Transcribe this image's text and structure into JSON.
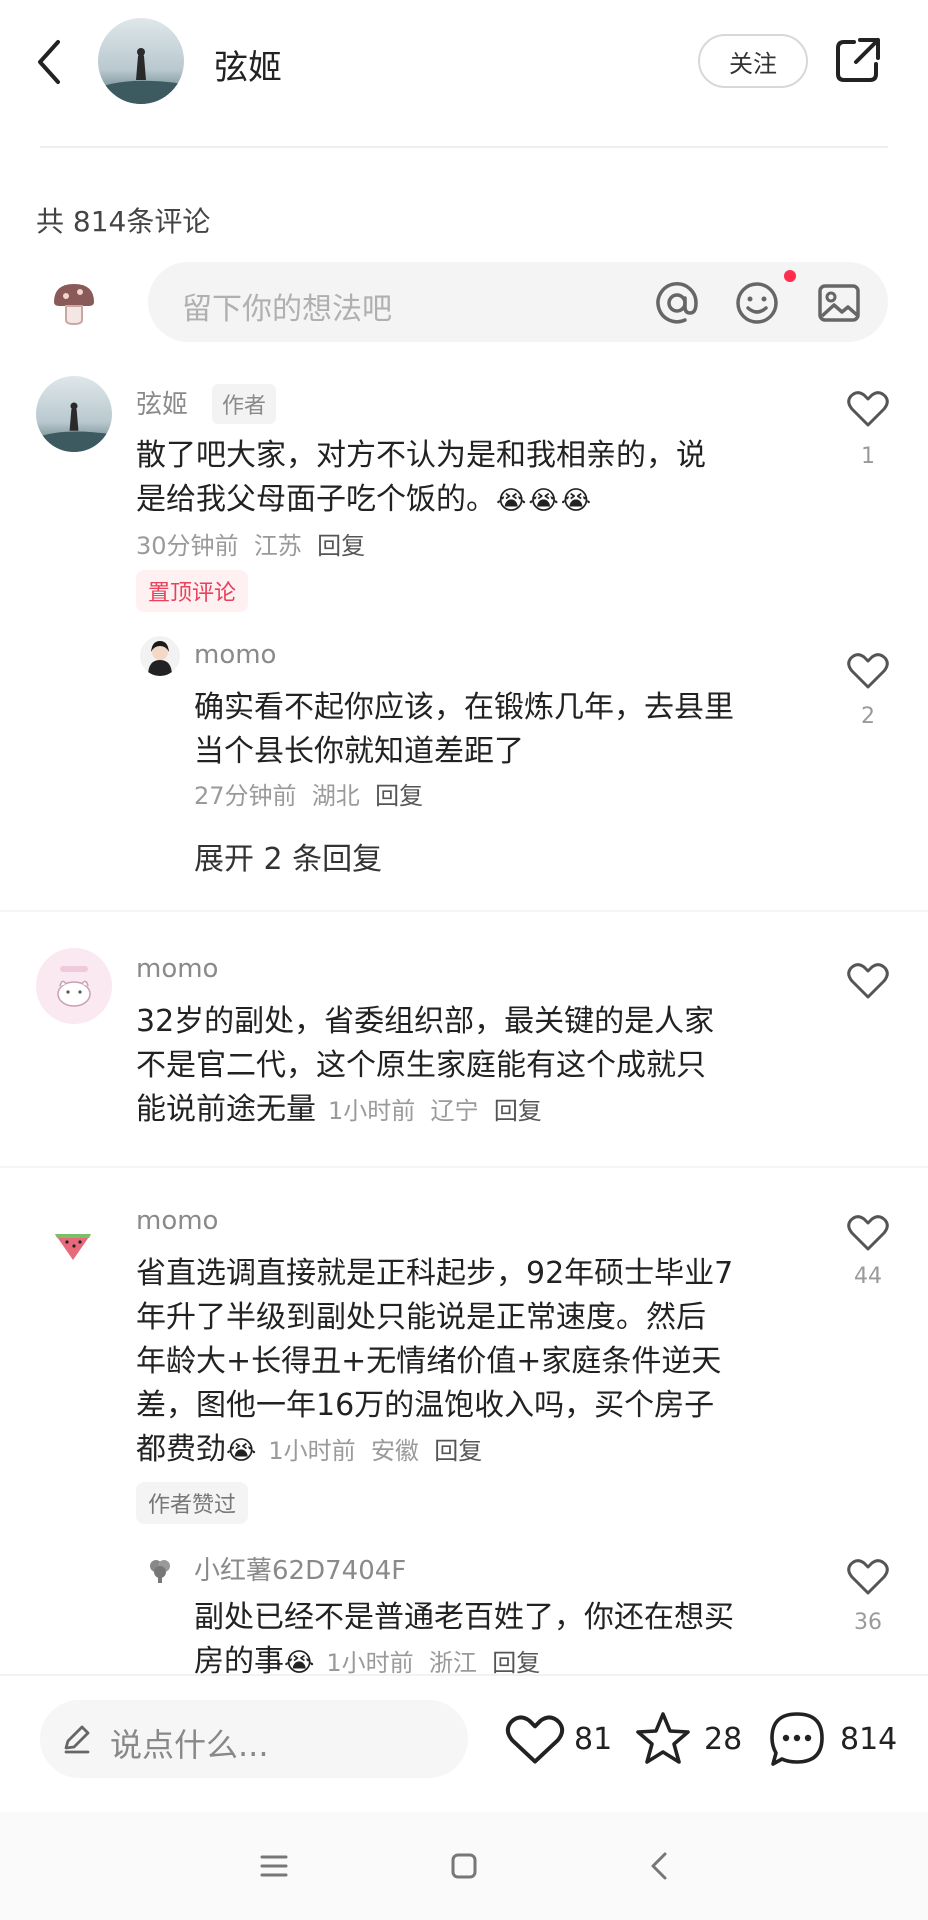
{
  "header": {
    "author_name": "弦姬",
    "follow_label": "关注"
  },
  "comments_count_label": "共 814条评论",
  "composer": {
    "placeholder": "留下你的想法吧"
  },
  "comments": [
    {
      "user": "弦姬",
      "author_tag": "作者",
      "text_lines": [
        "散了吧大家，对方不认为是和我相亲的，说",
        "是给我父母面子吃个饭的。"
      ],
      "meta": {
        "time": "30分钟前",
        "location": "江苏",
        "reply": "回复"
      },
      "pinned_tag": "置顶评论",
      "likes": "1",
      "reply": {
        "user": "momo",
        "text_lines": [
          "确实看不起你应该，在锻炼几年，去县里",
          "当个县长你就知道差距了"
        ],
        "meta": {
          "time": "27分钟前",
          "location": "湖北",
          "reply": "回复"
        },
        "likes": "2"
      },
      "expand_label": "展开 2 条回复"
    },
    {
      "user": "momo",
      "text_lines": [
        "32岁的副处，省委组织部，最关键的是人家",
        "不是官二代，这个原生家庭能有这个成就只",
        "能说前途无量"
      ],
      "meta": {
        "time": "1小时前",
        "location": "辽宁",
        "reply": "回复"
      },
      "likes": ""
    },
    {
      "user": "momo",
      "text_lines": [
        "省直选调直接就是正科起步，92年硕士毕业7",
        "年升了半级到副处只能说是正常速度。然后",
        "年龄大+长得丑+无情绪价值+家庭条件逆天",
        "差，图他一年16万的温饱收入吗，买个房子",
        "都费劲"
      ],
      "meta": {
        "time": "1小时前",
        "location": "安徽",
        "reply": "回复"
      },
      "liked_tag": "作者赞过",
      "likes": "44",
      "reply": {
        "user": "小红薯62D7404F",
        "text_lines": [
          "副处已经不是普通老百姓了，你还在想买",
          "房的事"
        ],
        "meta": {
          "time": "1小时前",
          "location": "浙江",
          "reply": "回复"
        },
        "likes": "36"
      }
    }
  ],
  "bottom_bar": {
    "say_placeholder": "说点什么...",
    "like_count": "81",
    "star_count": "28",
    "comment_count": "814"
  },
  "colors": {
    "accent": "#ff2e4d",
    "pinned_text": "#e8415a",
    "muted": "#9a9a9a"
  }
}
